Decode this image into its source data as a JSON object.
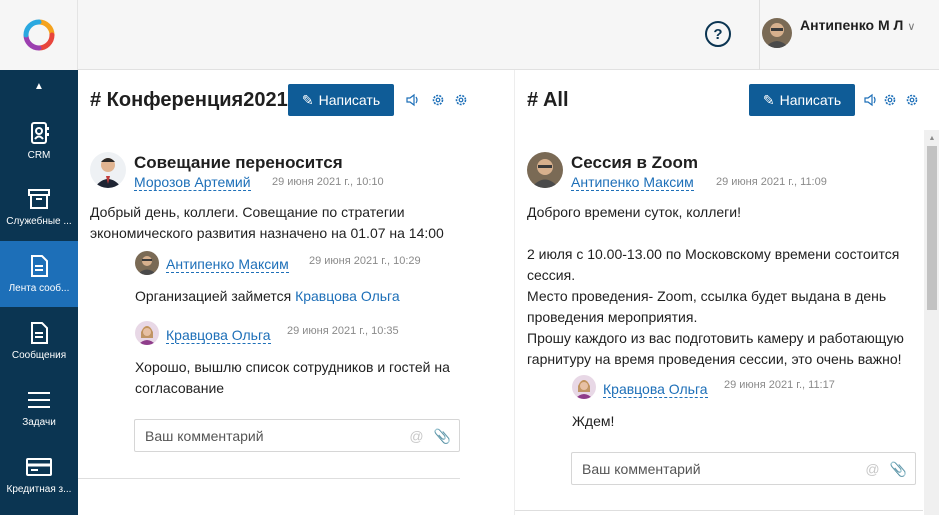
{
  "sidebar": {
    "items": [
      {
        "label": "CRM",
        "icon": "contact-card-icon",
        "active": false
      },
      {
        "label": "Служебные ...",
        "icon": "archive-box-icon",
        "active": false
      },
      {
        "label": "Лента сооб...",
        "icon": "document-feed-icon",
        "active": true
      },
      {
        "label": "Сообщения",
        "icon": "document-icon",
        "active": false
      },
      {
        "label": "Задачи",
        "icon": "menu-lines-icon",
        "active": false
      },
      {
        "label": "Кредитная з...",
        "icon": "credit-card-icon",
        "active": false
      }
    ],
    "accent_color": "#1d6fb8",
    "bg_color": "#0b3552"
  },
  "header": {
    "help_icon": "question-circle-icon",
    "user_name": "Антипенко М Л"
  },
  "left_column": {
    "channel_title": "# Конференция2021",
    "write_label": "Написать",
    "post": {
      "title": "Совещание переносится",
      "author": "Морозов Артемий",
      "time": "29 июня 2021 г., 10:10",
      "text_lines": [
        "Добрый день, коллеги. Совещание по стратегии",
        "экономического развития назначено на 01.07 на 14:00"
      ]
    },
    "comments": [
      {
        "author": "Антипенко Максим",
        "time": "29 июня 2021 г., 10:29",
        "text_prefix": "Организацией займется ",
        "mention": "Кравцова Ольга"
      },
      {
        "author": "Кравцова Ольга",
        "time": "29 июня 2021 г., 10:35",
        "text_lines": [
          "Хорошо, вышлю список сотрудников и гостей на",
          "согласование"
        ]
      }
    ],
    "comment_placeholder": "Ваш комментарий"
  },
  "right_column": {
    "channel_title": "# All",
    "write_label": "Написать",
    "post": {
      "title": "Сессия в Zoom",
      "author": "Антипенко Максим",
      "time": "29 июня 2021 г., 11:09",
      "text_lines": [
        "Доброго времени суток, коллеги!",
        "",
        "2 июля с 10.00-13.00 по Московскому времени состоится",
        "сессия.",
        "Место проведения- Zoom, ссылка будет выдана в день",
        "проведения мероприятия.",
        "Прошу каждого из вас подготовить камеру и работающую",
        "гарнитуру на время проведения сессии, это очень важно!"
      ]
    },
    "comments": [
      {
        "author": "Кравцова Ольга",
        "time": "29 июня 2021 г., 11:17",
        "text": "Ждем!"
      }
    ],
    "comment_placeholder": "Ваш комментарий"
  }
}
